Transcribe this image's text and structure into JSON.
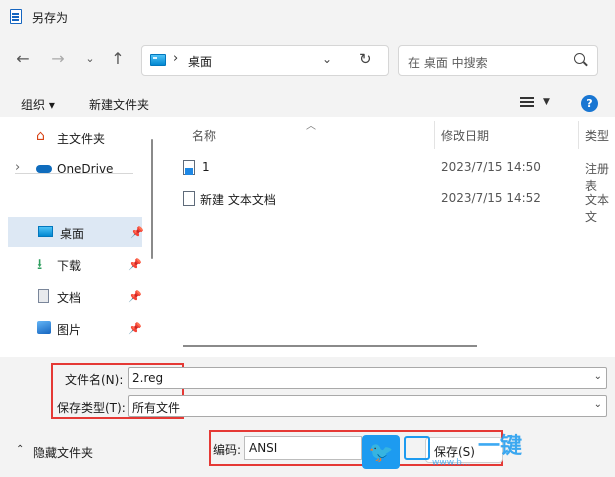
{
  "window": {
    "title": "另存为"
  },
  "address": {
    "separator": "›",
    "location": "桌面"
  },
  "search": {
    "placeholder": "在 桌面 中搜索"
  },
  "toolbar": {
    "organize": "组织 ▾",
    "new_folder": "新建文件夹",
    "help": "?"
  },
  "nav": {
    "items": [
      {
        "label": "主文件夹",
        "icon": "home-icon"
      },
      {
        "label": "OneDrive",
        "icon": "cloud-icon"
      },
      {
        "label": "桌面",
        "icon": "desktop-icon",
        "selected": true
      },
      {
        "label": "下载",
        "icon": "download-icon"
      },
      {
        "label": "文档",
        "icon": "document-icon"
      },
      {
        "label": "图片",
        "icon": "picture-icon"
      }
    ],
    "expand_glyph": "›"
  },
  "columns": {
    "name": "名称",
    "modified": "修改日期",
    "type": "类型"
  },
  "files": [
    {
      "name": "1",
      "modified": "2023/7/15 14:50",
      "type": "注册表"
    },
    {
      "name": "新建 文本文档",
      "modified": "2023/7/15 14:52",
      "type": "文本文"
    }
  ],
  "form": {
    "filename_label": "文件名(N):",
    "filename_value": "2.reg",
    "filetype_label": "保存类型(T):",
    "filetype_value": "所有文件",
    "hide_folders": "隐藏文件夹",
    "encoding_label": "编码:",
    "encoding_value": "ANSI",
    "save_button": "保存(S)"
  },
  "watermark": {
    "text": "一键",
    "url": "www.b..."
  },
  "colors": {
    "accent": "#1976d2",
    "selection": "#dde8f4",
    "highlight": "#e53935"
  }
}
